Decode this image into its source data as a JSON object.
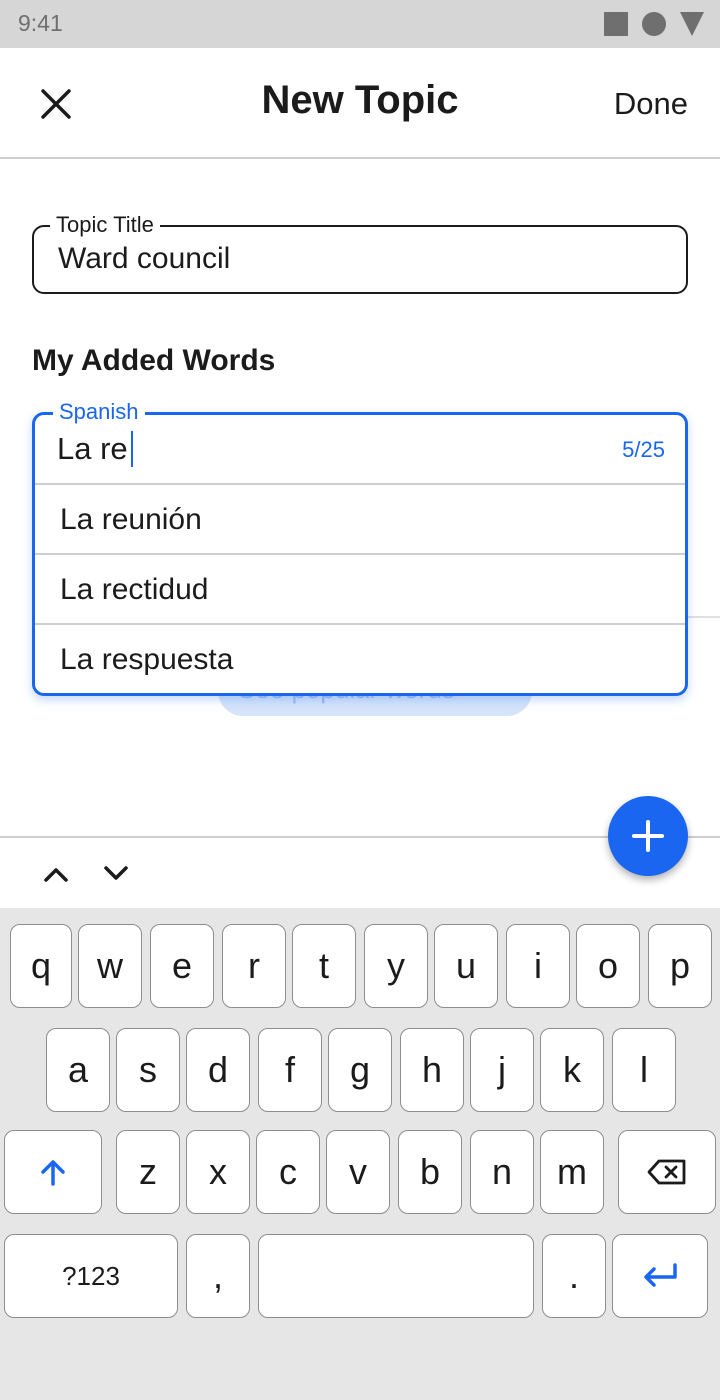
{
  "status_bar": {
    "time": "9:41"
  },
  "app_bar": {
    "title": "New Topic",
    "done_label": "Done"
  },
  "topic_title_field": {
    "label": "Topic Title",
    "value": "Ward council"
  },
  "section_heading": "My Added Words",
  "spanish_field": {
    "label": "Spanish",
    "value": "La re",
    "counter": "5/25",
    "suggestions": [
      "La reunión",
      "La rectidud",
      "La respuesta"
    ]
  },
  "popular_words_button": {
    "label": "See popular words ›"
  },
  "keyboard": {
    "row1": [
      "q",
      "w",
      "e",
      "r",
      "t",
      "y",
      "u",
      "i",
      "o",
      "p"
    ],
    "row2": [
      "a",
      "s",
      "d",
      "f",
      "g",
      "h",
      "j",
      "k",
      "l"
    ],
    "row3": [
      "z",
      "x",
      "c",
      "v",
      "b",
      "n",
      "m"
    ],
    "symbols_label": "?123",
    "comma_label": ",",
    "period_label": "."
  },
  "colors": {
    "accent": "#1a66f0",
    "keyboard_bg": "#e6e6e6",
    "status_bar_bg": "#d6d6d6"
  },
  "icons": {
    "close": "close-icon",
    "add": "plus-icon",
    "prev": "chevron-up-icon",
    "next": "chevron-down-icon",
    "shift": "shift-arrow-icon",
    "backspace": "backspace-icon",
    "enter": "enter-icon"
  }
}
